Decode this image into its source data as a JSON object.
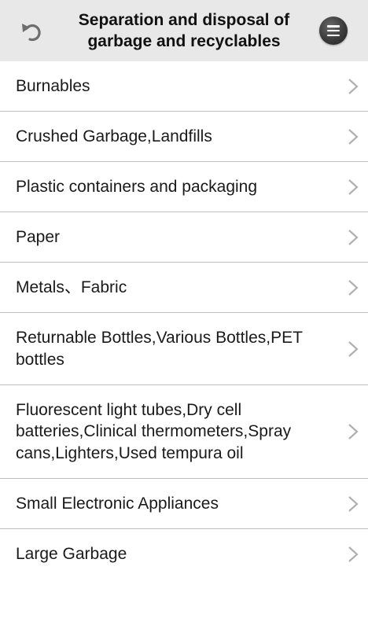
{
  "header": {
    "title": "Separation and disposal of garbage and recyclables",
    "back_icon": "undo-arrow-icon",
    "menu_icon": "hamburger-menu-icon"
  },
  "categories": [
    {
      "label": "Burnables"
    },
    {
      "label": "Crushed Garbage,Landfills"
    },
    {
      "label": "Plastic containers and packaging"
    },
    {
      "label": "Paper"
    },
    {
      "label": "Metals、Fabric"
    },
    {
      "label": "Returnable Bottles,Various Bottles,PET bottles"
    },
    {
      "label": "Fluorescent light tubes,Dry cell batteries,Clinical thermometers,Spray cans,Lighters,Used tempura oil"
    },
    {
      "label": "Small Electronic Appliances"
    },
    {
      "label": "Large Garbage"
    }
  ],
  "colors": {
    "header_bg": "#e8e8e8",
    "divider": "#bdbdbd",
    "chevron": "#b0b0b0",
    "text": "#1a1a1a"
  }
}
